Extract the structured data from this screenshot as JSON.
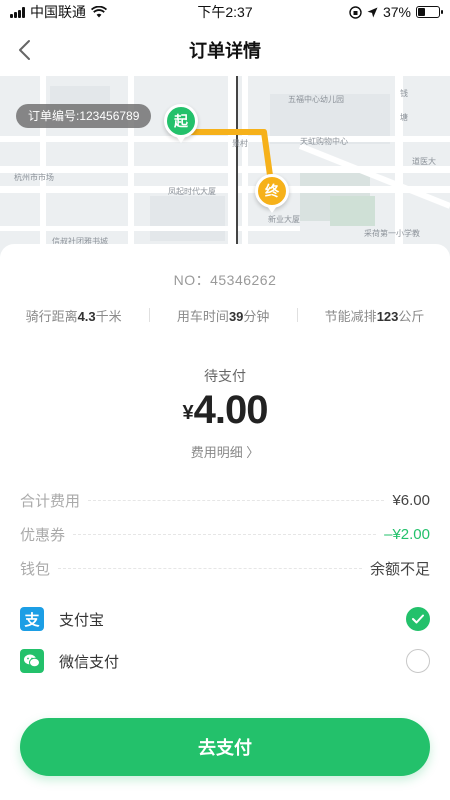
{
  "status_bar": {
    "carrier": "中国联通",
    "time": "下午2:37",
    "battery_pct": "37%",
    "battery_level": 0.37
  },
  "nav": {
    "title": "订单详情",
    "back_icon": "chevron-left-icon"
  },
  "map": {
    "order_chip": "订单编号:123456789",
    "start_label": "起",
    "end_label": "终",
    "start_color": "#23c16b",
    "end_color": "#f6b11a",
    "route_color": "#f6b11a",
    "places": [
      "五福中心幼儿园",
      "天虹购物中心",
      "杭州市市场",
      "凤起时代大厦",
      "新业大厦",
      "采荷第一小学教",
      "道医大",
      "钱",
      "塘",
      "信叔社团雅书城",
      "景村"
    ]
  },
  "order": {
    "number": "NO：45346262",
    "stats": [
      {
        "prefix": "骑行距离",
        "value": "4.3",
        "suffix": "千米"
      },
      {
        "prefix": "用车时间",
        "value": "39",
        "suffix": "分钟"
      },
      {
        "prefix": "节能减排",
        "value": "123",
        "suffix": "公斤"
      }
    ],
    "status": "待支付",
    "currency": "¥",
    "amount": "4.00",
    "detail_link": "费用明细 〉"
  },
  "fees": [
    {
      "label": "合计费用",
      "value": "¥6.00"
    },
    {
      "label": "优惠券",
      "value": "–¥2.00"
    },
    {
      "label": "钱包",
      "value": "余额不足"
    }
  ],
  "payment_methods": [
    {
      "name": "支付宝",
      "icon": "alipay-icon",
      "icon_glyph": "支",
      "selected": true
    },
    {
      "name": "微信支付",
      "icon": "wechat-icon",
      "selected": false
    }
  ],
  "submit_label": "去支付",
  "colors": {
    "accent": "#23c16b",
    "discount": "#23c16b",
    "alipay": "#1c9ee5"
  }
}
